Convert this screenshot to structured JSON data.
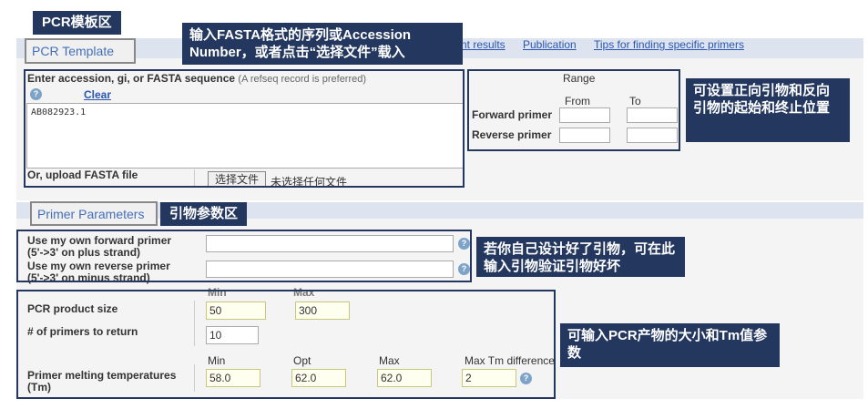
{
  "labels": {
    "pcr_template_area": "PCR模板区",
    "primer_param_area": "引物参数区"
  },
  "callouts": {
    "template": "输入FASTA格式的序列或Accession Number，或者点击“选择文件”载入",
    "range": "可设置正向引物和反向引物的起始和终止位置",
    "own_primer": "若你自己设计好了引物，可在此输入引物验证引物好坏",
    "product": "可输入PCR产物的大小和Tm值参数"
  },
  "top_links": {
    "results": "nt results",
    "publication": "Publication",
    "tips": "Tips for finding specific primers"
  },
  "pcr_template": {
    "tab": "PCR Template",
    "enter_label": "Enter accession, gi, or FASTA sequence",
    "enter_hint": "(A refseq record is preferred)",
    "clear": "Clear",
    "sequence_value": "AB082923.1",
    "upload_label": "Or, upload FASTA file",
    "choose_file": "选择文件",
    "no_file": "未选择任何文件"
  },
  "range": {
    "title": "Range",
    "from": "From",
    "to": "To",
    "forward": "Forward primer",
    "reverse": "Reverse primer"
  },
  "primer_parameters": {
    "tab": "Primer Parameters",
    "own_forward": "Use my own forward primer",
    "own_forward_sub": "(5'->3' on plus strand)",
    "own_reverse": "Use my own reverse primer",
    "own_reverse_sub": "(5'->3' on minus strand)"
  },
  "product": {
    "min_head": "Min",
    "max_head": "Max",
    "size_label": "PCR product size",
    "size_min": "50",
    "size_max": "300",
    "num_label": "# of primers to return",
    "num_value": "10",
    "tm_min_head": "Min",
    "tm_opt_head": "Opt",
    "tm_max_head": "Max",
    "tm_diff_head": "Max Tm difference",
    "tm_label": "Primer melting temperatures (Tm)",
    "tm_min": "58.0",
    "tm_opt": "62.0",
    "tm_max": "62.0",
    "tm_diff": "2"
  },
  "icons": {
    "help": "help-icon"
  },
  "colors": {
    "callout_bg": "#23375f",
    "section_band": "#dde4ef",
    "link": "#2a56b0",
    "tab_text": "#446fb7"
  }
}
